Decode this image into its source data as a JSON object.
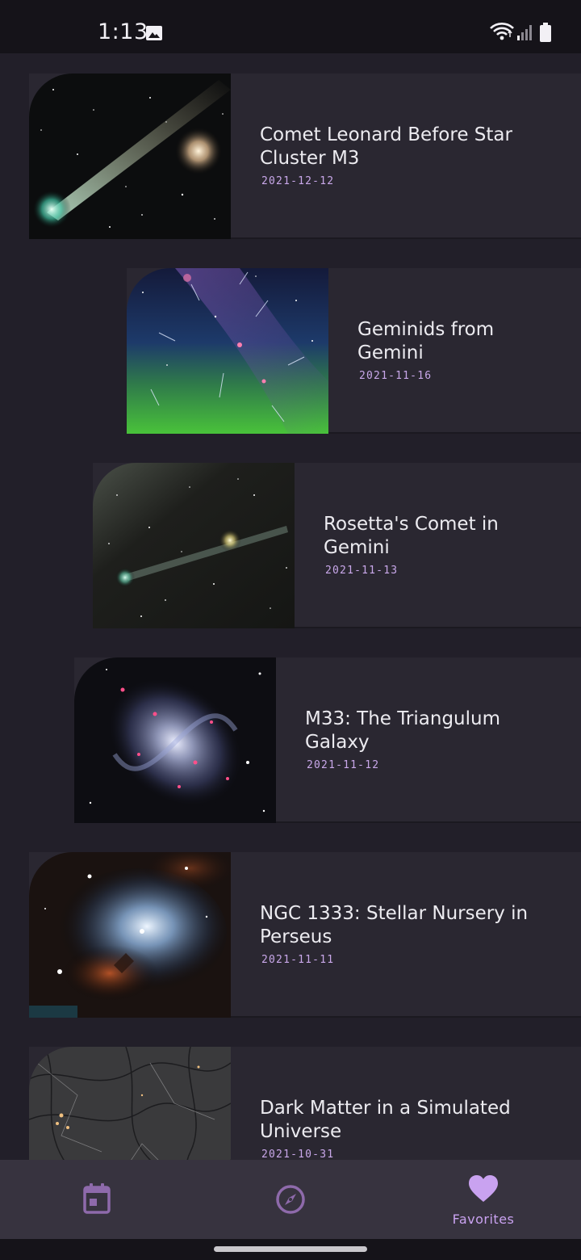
{
  "status_bar": {
    "time": "1:13",
    "icons": [
      "gallery-icon",
      "wifi-icon",
      "signal-icon",
      "battery-icon"
    ]
  },
  "items": [
    {
      "title": "Comet Leonard Before Star Cluster M3",
      "date": "2021-12-12"
    },
    {
      "title": "Geminids from Gemini",
      "date": "2021-11-16"
    },
    {
      "title": "Rosetta's Comet in Gemini",
      "date": "2021-11-13"
    },
    {
      "title": "M33: The Triangulum Galaxy",
      "date": "2021-11-12"
    },
    {
      "title": "NGC 1333: Stellar Nursery in Perseus",
      "date": "2021-11-11"
    },
    {
      "title": "Dark Matter in a Simulated Universe",
      "date": "2021-10-31"
    }
  ],
  "bottom_nav": {
    "items": [
      {
        "icon": "calendar-icon",
        "label": "",
        "active": false
      },
      {
        "icon": "compass-icon",
        "label": "",
        "active": false
      },
      {
        "icon": "heart-icon",
        "label": "Favorites",
        "active": true
      }
    ]
  },
  "colors": {
    "background": "#221f29",
    "card": "#2a2731",
    "accent": "#c9a2f0",
    "nav_bar": "#37333f",
    "inactive_icon": "#8e6aab"
  }
}
